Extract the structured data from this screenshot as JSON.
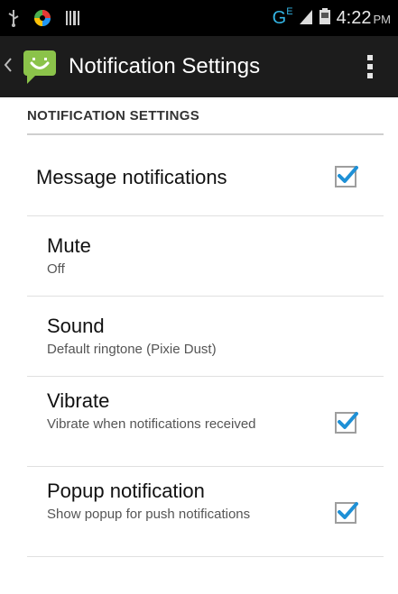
{
  "status_bar": {
    "icons": [
      "usb-icon",
      "app-notification-icon",
      "barcode-icon",
      "network-edge-icon",
      "signal-icon",
      "battery-icon"
    ],
    "network_label": "G",
    "network_sup": "E",
    "time": "4:22",
    "ampm": "PM"
  },
  "action_bar": {
    "title": "Notification Settings",
    "app_icon": "messaging-smiley-icon",
    "menu_icon": "overflow-menu-icon"
  },
  "section": {
    "header": "NOTIFICATION SETTINGS"
  },
  "prefs": [
    {
      "title": "Message notifications",
      "summary": "",
      "checked": true
    },
    {
      "title": "Mute",
      "summary": "Off"
    },
    {
      "title": "Sound",
      "summary": "Default ringtone (Pixie Dust)"
    },
    {
      "title": "Vibrate",
      "summary": "Vibrate when notifications received",
      "checked": true
    },
    {
      "title": "Popup notification",
      "summary": "Show popup for push notifications",
      "checked": true
    }
  ],
  "colors": {
    "accent": "#33b5e5",
    "checkmark": "#1e90d6",
    "app_icon_green": "#8bc34a"
  }
}
